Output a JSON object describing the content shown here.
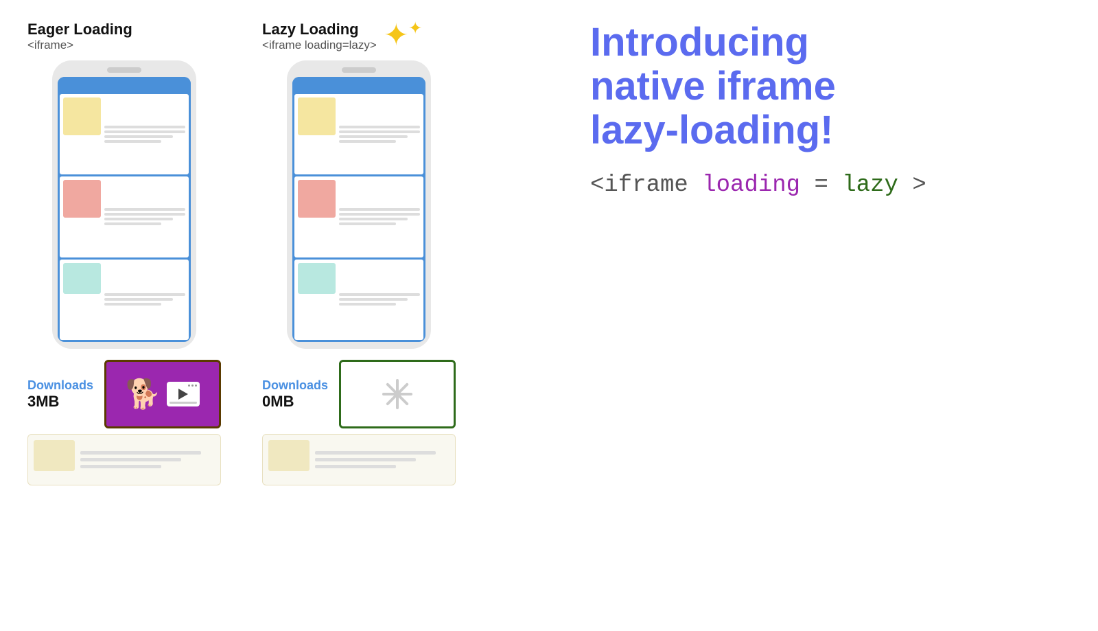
{
  "eager": {
    "title": "Eager Loading",
    "subtitle": "<iframe>",
    "downloads_label": "Downloads",
    "downloads_size": "3MB"
  },
  "lazy": {
    "title": "Lazy Loading",
    "subtitle": "<iframe loading=lazy>",
    "downloads_label": "Downloads",
    "downloads_size": "0MB"
  },
  "intro": {
    "line1": "Introducing",
    "line2": "native iframe",
    "line3": "lazy-loading!"
  },
  "code": {
    "prefix": "<iframe ",
    "attr": "loading",
    "equals": "=",
    "value": "lazy",
    "suffix": ">"
  },
  "sparkle": "✦"
}
